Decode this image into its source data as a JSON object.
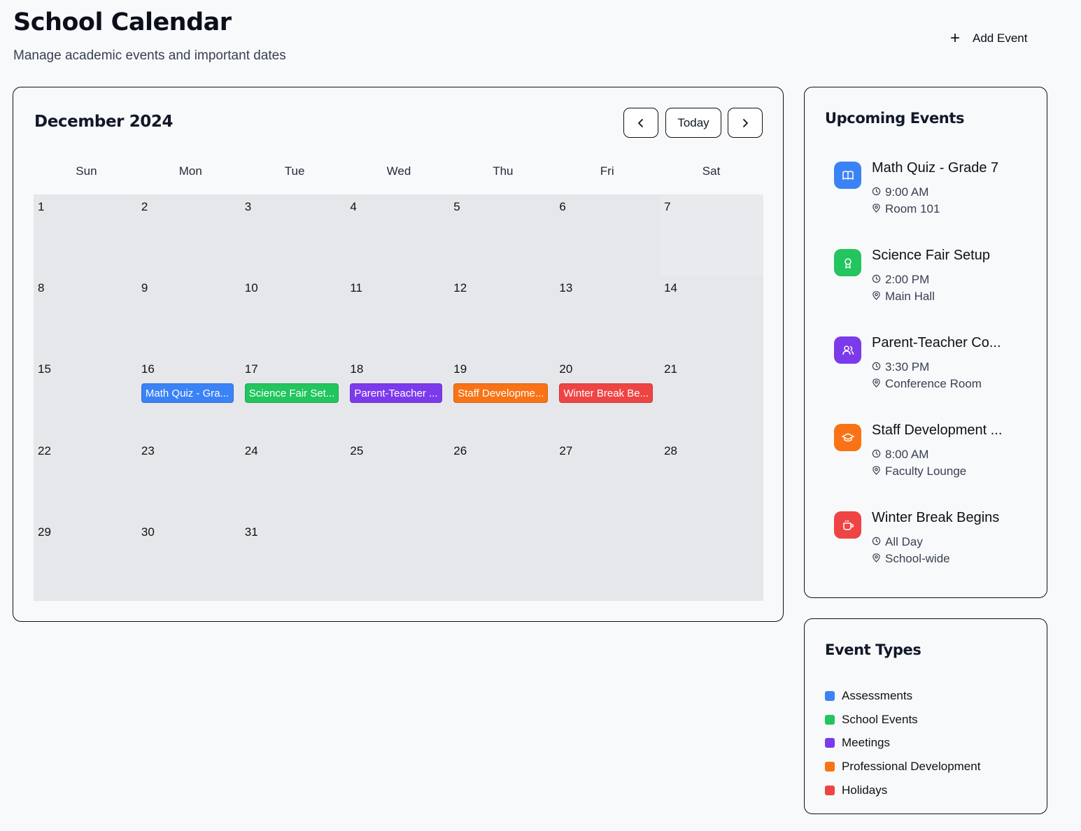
{
  "header": {
    "title": "School Calendar",
    "subtitle": "Manage academic events and important dates",
    "add_event_label": "Add Event"
  },
  "calendar": {
    "month_title": "December 2024",
    "today_label": "Today",
    "weekdays": [
      "Sun",
      "Mon",
      "Tue",
      "Wed",
      "Thu",
      "Fri",
      "Sat"
    ],
    "days": [
      {
        "num": "1"
      },
      {
        "num": "2"
      },
      {
        "num": "3"
      },
      {
        "num": "4"
      },
      {
        "num": "5"
      },
      {
        "num": "6"
      },
      {
        "num": "7"
      },
      {
        "num": "8"
      },
      {
        "num": "9"
      },
      {
        "num": "10"
      },
      {
        "num": "11"
      },
      {
        "num": "12"
      },
      {
        "num": "13"
      },
      {
        "num": "14"
      },
      {
        "num": "15"
      },
      {
        "num": "16",
        "event": "Math Quiz - Gra...",
        "color": "#3b82f6"
      },
      {
        "num": "17",
        "event": "Science Fair Set...",
        "color": "#22c55e"
      },
      {
        "num": "18",
        "event": "Parent-Teacher ...",
        "color": "#7c3aed"
      },
      {
        "num": "19",
        "event": "Staff Developme...",
        "color": "#f97316"
      },
      {
        "num": "20",
        "event": "Winter Break Be...",
        "color": "#ef4444"
      },
      {
        "num": "21"
      },
      {
        "num": "22"
      },
      {
        "num": "23"
      },
      {
        "num": "24"
      },
      {
        "num": "25"
      },
      {
        "num": "26"
      },
      {
        "num": "27"
      },
      {
        "num": "28"
      },
      {
        "num": "29"
      },
      {
        "num": "30"
      },
      {
        "num": "31"
      },
      {
        "num": ""
      },
      {
        "num": ""
      },
      {
        "num": ""
      },
      {
        "num": ""
      }
    ]
  },
  "upcoming": {
    "title": "Upcoming Events",
    "items": [
      {
        "title": "Math Quiz - Grade 7",
        "time": "9:00 AM",
        "location": "Room 101",
        "color": "#3b82f6",
        "icon": "book-icon"
      },
      {
        "title": "Science Fair Setup",
        "time": "2:00 PM",
        "location": "Main Hall",
        "color": "#22c55e",
        "icon": "award-icon"
      },
      {
        "title": "Parent-Teacher Co...",
        "time": "3:30 PM",
        "location": "Conference Room",
        "color": "#7c3aed",
        "icon": "users-icon"
      },
      {
        "title": "Staff Development ...",
        "time": "8:00 AM",
        "location": "Faculty Lounge",
        "color": "#f97316",
        "icon": "graduation-cap-icon"
      },
      {
        "title": "Winter Break Begins",
        "time": "All Day",
        "location": "School-wide",
        "color": "#ef4444",
        "icon": "coffee-icon"
      }
    ]
  },
  "event_types": {
    "title": "Event Types",
    "items": [
      {
        "label": "Assessments",
        "color": "#3b82f6"
      },
      {
        "label": "School Events",
        "color": "#22c55e"
      },
      {
        "label": "Meetings",
        "color": "#7c3aed"
      },
      {
        "label": "Professional Development",
        "color": "#f97316"
      },
      {
        "label": "Holidays",
        "color": "#ef4444"
      }
    ]
  }
}
